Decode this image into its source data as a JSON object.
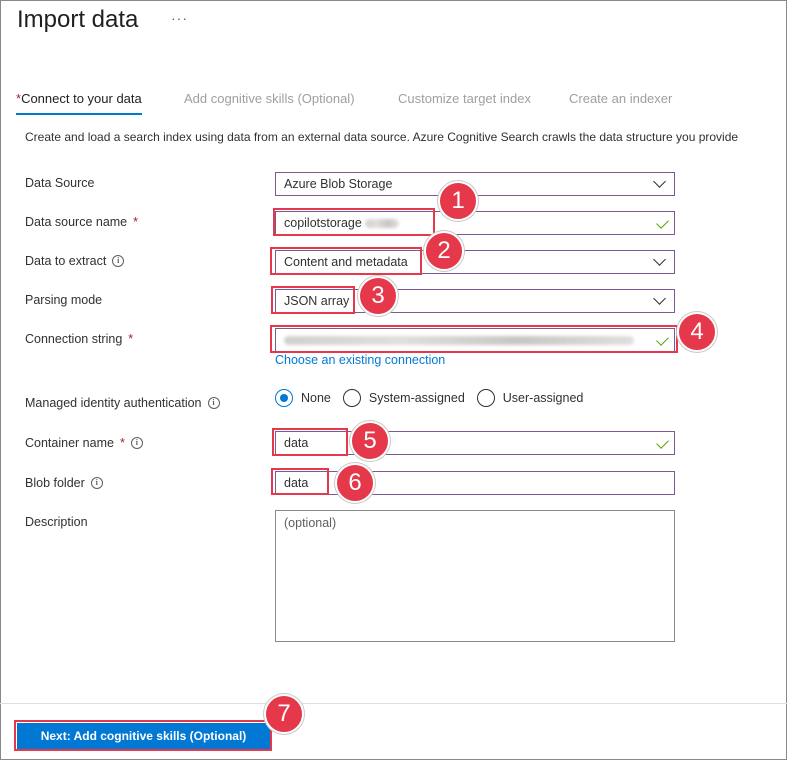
{
  "header": {
    "title": "Import data",
    "more_label": "···"
  },
  "tabs": [
    {
      "label": "Connect to your data",
      "active": true,
      "required": true
    },
    {
      "label": "Add cognitive skills (Optional)",
      "active": false
    },
    {
      "label": "Customize target index",
      "active": false
    },
    {
      "label": "Create an indexer",
      "active": false
    }
  ],
  "intro": "Create and load a search index using data from an external data source. Azure Cognitive Search crawls the data structure you provide",
  "form": {
    "data_source": {
      "label": "Data Source",
      "value": "Azure Blob Storage"
    },
    "data_source_name": {
      "label": "Data source name",
      "required": "*",
      "value": "copilotstorage"
    },
    "data_to_extract": {
      "label": "Data to extract",
      "value": "Content and metadata"
    },
    "parsing_mode": {
      "label": "Parsing mode",
      "value": "JSON array"
    },
    "connection_string": {
      "label": "Connection string",
      "required": "*",
      "link": "Choose an existing connection"
    },
    "managed_identity": {
      "label": "Managed identity authentication",
      "options": [
        "None",
        "System-assigned",
        "User-assigned"
      ],
      "selected": "None"
    },
    "container_name": {
      "label": "Container name",
      "required": "*",
      "value": "data"
    },
    "blob_folder": {
      "label": "Blob folder",
      "value": "data"
    },
    "description": {
      "label": "Description",
      "placeholder": "(optional)"
    }
  },
  "footer": {
    "next_label": "Next: Add cognitive skills (Optional)"
  },
  "annotations": [
    "1",
    "2",
    "3",
    "4",
    "5",
    "6",
    "7"
  ],
  "colors": {
    "accent": "#0078d4",
    "annotation": "#e5384a",
    "valid_check": "#57a300",
    "required": "#a4262c"
  }
}
